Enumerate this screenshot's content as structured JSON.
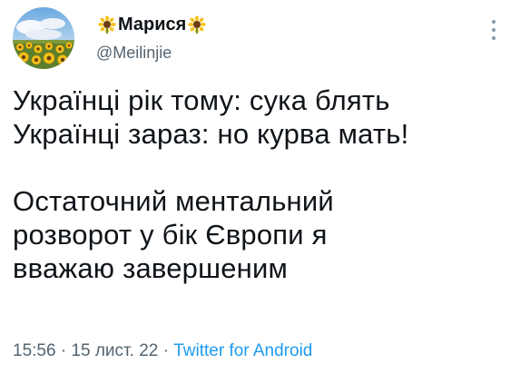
{
  "author": {
    "display_name": "Марися",
    "handle": "@Meilinjie",
    "avatar_icon": "sunflower-field-avatar",
    "name_decoration_icon": "sunflower-icon"
  },
  "tweet": {
    "lines_block_1": [
      "Українці рік тому: сука блять",
      "Українці зараз: но курва мать!"
    ],
    "lines_block_2": [
      "Остаточний ментальний",
      "розворот у бік Європи я",
      "вважаю завершеним"
    ]
  },
  "meta": {
    "time": "15:56",
    "separator_1": " · ",
    "date": "15 лист. 22",
    "separator_2": " · ",
    "source": "Twitter for Android"
  },
  "colors": {
    "text": "#0f1419",
    "secondary": "#536471",
    "link": "#1d9bf0"
  }
}
